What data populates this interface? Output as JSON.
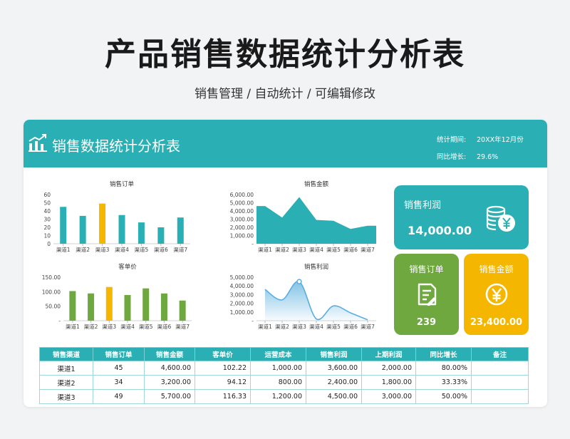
{
  "page": {
    "title": "产品销售数据统计分析表",
    "subtitle": "销售管理 / 自动统计 / 可编辑修改"
  },
  "header": {
    "title": "销售数据统计分析表",
    "period_label": "统计期间:",
    "period_value": "20XX年12月份",
    "growth_label": "同比增长:",
    "growth_value": "29.6%"
  },
  "colors": {
    "teal": "#2ab0b4",
    "yellow": "#f5b600",
    "green": "#6ea83f",
    "light_blue": "#5aaede"
  },
  "kpis": {
    "profit": {
      "label": "销售利润",
      "value": "14,000.00",
      "icon": "coins-yen-icon"
    },
    "orders": {
      "label": "销售订单",
      "value": "239",
      "icon": "document-icon"
    },
    "amount": {
      "label": "销售金额",
      "value": "23,400.00",
      "icon": "yen-circle-icon"
    }
  },
  "chart_data": [
    {
      "id": "orders",
      "type": "bar",
      "title": "销售订单",
      "categories": [
        "渠道1",
        "渠道2",
        "渠道3",
        "渠道4",
        "渠道5",
        "渠道6",
        "渠道7"
      ],
      "values": [
        45,
        34,
        49,
        35,
        26,
        20,
        32
      ],
      "ylim": [
        0,
        60
      ],
      "yticks": [
        "0",
        "10",
        "20",
        "30",
        "40",
        "50",
        "60"
      ],
      "highlight_index": 2,
      "color": "#2ab0b4",
      "highlight_color": "#f5b600"
    },
    {
      "id": "amount",
      "type": "area",
      "title": "销售金额",
      "categories": [
        "渠道1",
        "渠道2",
        "渠道3",
        "渠道4",
        "渠道5",
        "渠道6",
        "渠道7"
      ],
      "values": [
        4600,
        3200,
        5700,
        2900,
        2800,
        1800,
        2200
      ],
      "ylim": [
        0,
        6000
      ],
      "yticks": [
        "-",
        "1,000.00",
        "2,000.00",
        "3,000.00",
        "4,000.00",
        "5,000.00",
        "6,000.00"
      ],
      "color": "#2ab0b4"
    },
    {
      "id": "unit_price",
      "type": "bar",
      "title": "客单价",
      "categories": [
        "渠道1",
        "渠道2",
        "渠道3",
        "渠道4",
        "渠道5",
        "渠道6",
        "渠道7"
      ],
      "values": [
        102.22,
        94.12,
        116.33,
        88.6,
        111.5,
        94.0,
        69.5
      ],
      "ylim": [
        0,
        150
      ],
      "yticks": [
        "-",
        "50.00",
        "100.00",
        "150.00"
      ],
      "highlight_index": 2,
      "color": "#6ea83f",
      "highlight_color": "#f5b600"
    },
    {
      "id": "profit",
      "type": "area",
      "title": "销售利润",
      "categories": [
        "渠道1",
        "渠道2",
        "渠道3",
        "渠道4",
        "渠道5",
        "渠道6",
        "渠道7"
      ],
      "values": [
        3600,
        2400,
        4500,
        200,
        1700,
        900,
        100
      ],
      "ylim": [
        0,
        5000
      ],
      "yticks": [
        "-",
        "1,000.00",
        "2,000.00",
        "3,000.00",
        "4,000.00",
        "5,000.00"
      ],
      "color": "#5aaede",
      "highlight_index": 2
    }
  ],
  "table": {
    "columns": [
      "销售渠道",
      "销售订单",
      "销售金额",
      "客单价",
      "运营成本",
      "销售利润",
      "上期利润",
      "同比增长",
      "备注"
    ],
    "rows": [
      [
        "渠道1",
        "45",
        "4,600.00",
        "102.22",
        "1,000.00",
        "3,600.00",
        "2,000.00",
        "80.00%",
        ""
      ],
      [
        "渠道2",
        "34",
        "3,200.00",
        "94.12",
        "800.00",
        "2,400.00",
        "1,800.00",
        "33.33%",
        ""
      ],
      [
        "渠道3",
        "49",
        "5,700.00",
        "116.33",
        "1,200.00",
        "4,500.00",
        "3,000.00",
        "50.00%",
        ""
      ]
    ]
  }
}
